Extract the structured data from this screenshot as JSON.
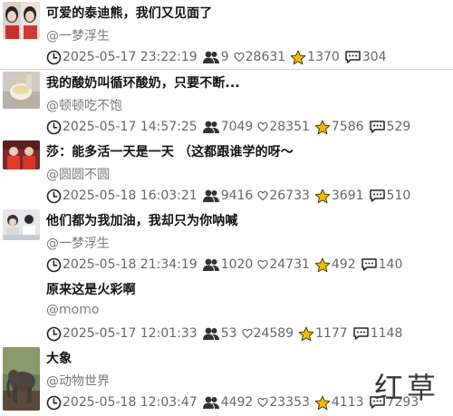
{
  "items": [
    {
      "title": "可爱的泰迪熊，我们又见面了",
      "author": "@一梦浮生",
      "date": "2025-05-17 23:22:19",
      "comments": "9",
      "likes": "28631",
      "favorites": "1370",
      "shares": "304",
      "thumb": "twin-girls-photo"
    },
    {
      "title": "我的酸奶叫循环酸奶，只要不断...",
      "author": "@顿顿吃不饱",
      "date": "2025-05-17 14:57:25",
      "comments": "7049",
      "likes": "28351",
      "favorites": "7586",
      "shares": "529",
      "thumb": "yogurt-photo"
    },
    {
      "title": "莎：能多活一天是一天 （这都跟谁学的呀～",
      "author": "@圆圆不圆",
      "date": "2025-05-18 16:03:21",
      "comments": "9416",
      "likes": "26733",
      "favorites": "3691",
      "shares": "510",
      "thumb": "athletes-photo"
    },
    {
      "title": "他们都为我加油，我却只为你呐喊",
      "author": "@一梦浮生",
      "date": "2025-05-18 21:34:19",
      "comments": "1020",
      "likes": "24731",
      "favorites": "492",
      "shares": "140",
      "thumb": "crowd-photo"
    },
    {
      "title": "原来这是火彩啊",
      "author": "@momo",
      "date": "2025-05-17 12:01:33",
      "comments": "53",
      "likes": "24589",
      "favorites": "1177",
      "shares": "1148",
      "thumb": ""
    },
    {
      "title": "大象",
      "author": "@动物世界",
      "date": "2025-05-18 12:03:47",
      "comments": "4492",
      "likes": "23353",
      "favorites": "4113",
      "shares": "7293",
      "thumb": "elephant-photo"
    }
  ],
  "icons": {
    "date": "clock-icon",
    "comments": "users-icon",
    "likes": "heart-icon",
    "favorites": "star-icon",
    "shares": "chat-bubble-icon"
  },
  "watermark": "红草",
  "colors": {
    "star": "#f5b800",
    "divider": "#d6d6d6",
    "meta_text": "#666666",
    "author_text": "#7a7a7a"
  }
}
